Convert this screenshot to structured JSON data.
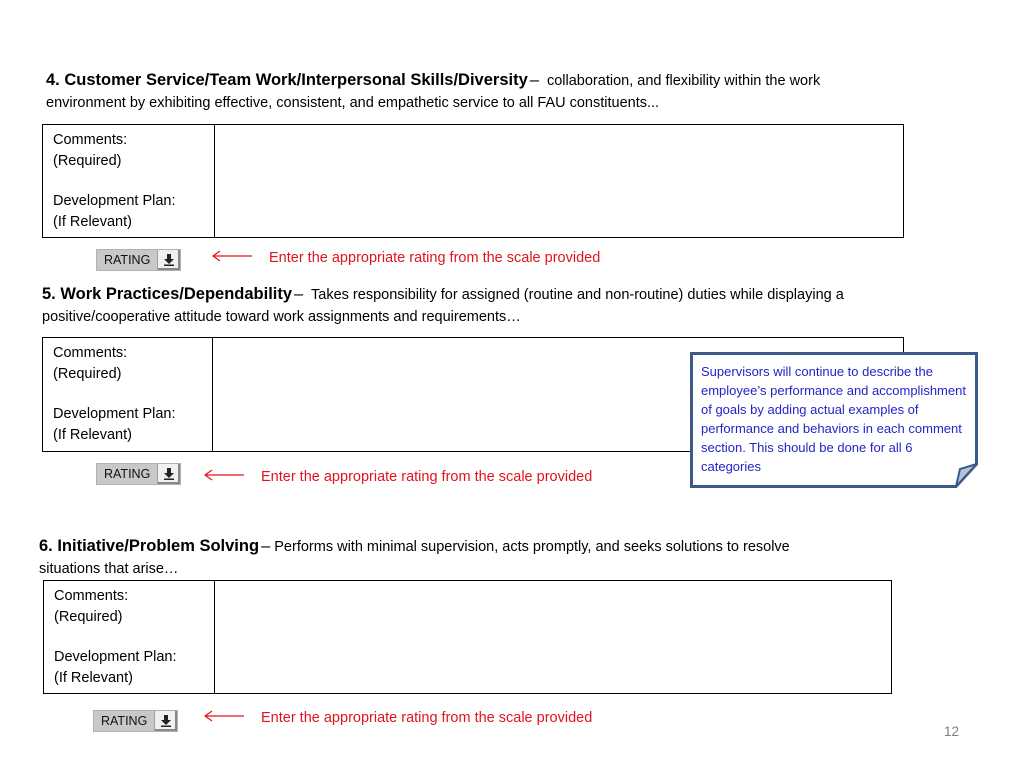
{
  "sections": [
    {
      "title": "4. Customer Service/Team Work/Interpersonal Skills/Diversity",
      "dash": "–",
      "desc": "collaboration, and flexibility within the work",
      "line2": "environment by exhibiting effective, consistent, and empathetic service to all FAU constituents...",
      "labels": {
        "comments": "Comments:",
        "required": "(Required)",
        "plan": "Development Plan:",
        "relevant": "(If Relevant)"
      },
      "comment_value": "",
      "rating_label": "RATING",
      "hint": "Enter the appropriate rating from the scale provided"
    },
    {
      "title": "5. Work Practices/Dependability",
      "dash": "–",
      "desc": "Takes responsibility for assigned (routine and non-routine) duties while displaying a",
      "line2": "positive/cooperative attitude toward work assignments and requirements…",
      "labels": {
        "comments": "Comments:",
        "required": "(Required)",
        "plan": "Development Plan:",
        "relevant": "(If Relevant)"
      },
      "comment_value": "",
      "rating_label": "RATING",
      "hint": "Enter the appropriate rating from the scale provided"
    },
    {
      "title": "6. Initiative/Problem Solving",
      "dash": "–",
      "desc": "Performs with minimal supervision, acts promptly, and seeks solutions to resolve",
      "line2": "situations that arise…",
      "labels": {
        "comments": "Comments:",
        "required": "(Required)",
        "plan": "Development Plan:",
        "relevant": "(If Relevant)"
      },
      "comment_value": "",
      "rating_label": "RATING",
      "hint": "Enter the appropriate rating from the scale provided"
    }
  ],
  "callout": {
    "text": "Supervisors will continue to describe the employee’s performance and accomplishment of goals by adding actual examples of performance and behaviors in each comment section.  This should be done for all 6 categories"
  },
  "page_number": "12",
  "colors": {
    "hint_red": "#e0141e",
    "callout_text": "#2424c8",
    "callout_border": "#3a5a8a"
  }
}
